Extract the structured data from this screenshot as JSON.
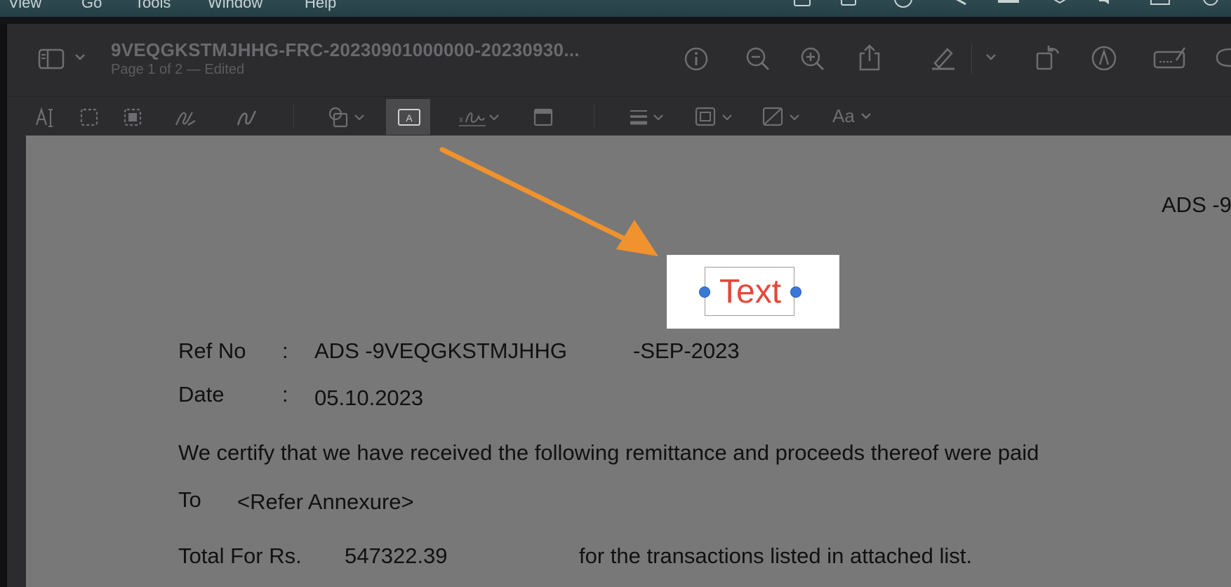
{
  "menubar": {
    "items": [
      "View",
      "Go",
      "Tools",
      "Window",
      "Help"
    ]
  },
  "window": {
    "title": "9VEQGKSTMJHHG-FRC-20230901000000-20230930...",
    "subtitle": "Page 1 of 2 — Edited"
  },
  "icons": {
    "sidebar": "sidebar-icon",
    "info": "info-icon",
    "zoom_out": "zoom-out-icon",
    "zoom_in": "zoom-in-icon",
    "share": "share-icon",
    "highlight": "highlight-icon",
    "rotate": "rotate-icon",
    "markup": "markup-icon",
    "form": "form-icon",
    "text_select": "text-selection-icon",
    "rect_select": "rectangular-selection-icon",
    "instant_alpha": "instant-alpha-icon",
    "sketch": "sketch-icon",
    "draw": "draw-icon",
    "shapes": "shapes-icon",
    "text_box": "text-box-icon",
    "sign": "signature-icon",
    "note": "note-icon",
    "line_style": "line-style-icon",
    "border_color": "border-color-icon",
    "fill_color": "fill-color-icon"
  },
  "toolbar2": {
    "font_label": "Aa"
  },
  "colors": {
    "accent_arrow": "#f0922e",
    "annotation_text": "#e5473a",
    "handle": "#3a78d8"
  },
  "document": {
    "header_right": "ADS -9",
    "annotation_text": "Text",
    "ref_label": "Ref No",
    "colon": ":",
    "ref_value": "ADS -9VEQGKSTMJHHG",
    "ref_suffix": "-SEP-2023",
    "date_label": "Date",
    "date_value": "05.10.2023",
    "certify_line": "We certify that we have received the following remittance and proceeds thereof were paid",
    "to_label": "To",
    "to_value": "<Refer Annexure>",
    "total_label": "Total For Rs.",
    "total_value": "547322.39",
    "total_suffix": "for the transactions listed in attached list."
  }
}
